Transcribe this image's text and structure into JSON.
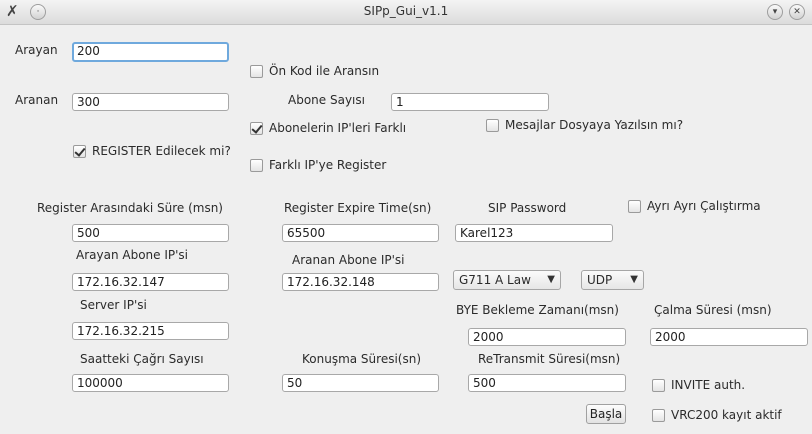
{
  "window": {
    "title": "SIPp_Gui_v1.1"
  },
  "labels": {
    "arayan": "Arayan",
    "aranan": "Aranan",
    "abone_sayisi": "Abone Sayısı",
    "register_arasi": "Register Arasındaki Süre (msn)",
    "register_expire": "Register Expire Time(sn)",
    "sip_password": "SIP Password",
    "arayan_ip": "Arayan Abone IP'si",
    "aranan_ip": "Aranan Abone IP'si",
    "server_ip": "Server IP'si",
    "bye_bekleme": "BYE Bekleme Zamanı(msn)",
    "calma_suresi": "Çalma Süresi (msn)",
    "saatteki_cagri": "Saatteki Çağrı Sayısı",
    "konusma_suresi": "Konuşma Süresi(sn)",
    "retransmit": "ReTransmit Süresi(msn)"
  },
  "values": {
    "arayan": "200",
    "aranan": "300",
    "abone_sayisi": "1",
    "register_arasi": "500",
    "register_expire": "65500",
    "sip_password": "Karel123",
    "arayan_ip": "172.16.32.147",
    "aranan_ip": "172.16.32.148",
    "server_ip": "172.16.32.215",
    "bye_bekleme": "2000",
    "calma_suresi": "2000",
    "saatteki_cagri": "100000",
    "konusma_suresi": "50",
    "retransmit": "500"
  },
  "checkboxes": {
    "on_kod": {
      "label": "Ön Kod ile Aransın",
      "checked": false
    },
    "ip_farkli": {
      "label": "Abonelerin IP'leri Farklı",
      "checked": true
    },
    "mesajlar": {
      "label": "Mesajlar Dosyaya Yazılsın mı?",
      "checked": false
    },
    "register_edilecek": {
      "label": "REGISTER Edilecek mi?",
      "checked": true
    },
    "farkli_ip_register": {
      "label": "Farklı IP'ye Register",
      "checked": false
    },
    "ayri_calistirma": {
      "label": "Ayrı Ayrı Çalıştırma",
      "checked": false
    },
    "invite_auth": {
      "label": "INVITE auth.",
      "checked": false
    },
    "vrc200": {
      "label": "VRC200 kayıt aktif",
      "checked": false
    }
  },
  "selects": {
    "codec": "G711 A Law",
    "transport": "UDP"
  },
  "buttons": {
    "basla": "Başla"
  },
  "icons": {
    "app": "app-x-icon",
    "menu": "window-menu-icon",
    "minimize": "minimize-icon",
    "close": "close-icon"
  }
}
